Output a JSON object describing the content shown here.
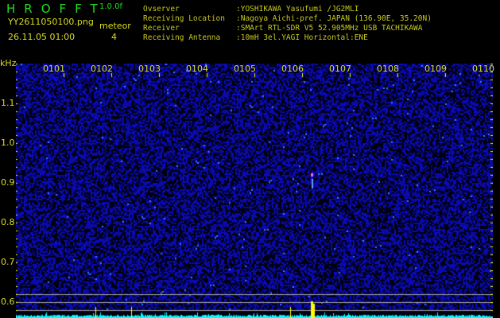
{
  "header": {
    "title": "HROFFT",
    "version": "1.0.0f",
    "filename": "YY2611050100.png",
    "datetime": "26.11.05 01:00",
    "meteor_label": "meteor",
    "meteor_count": "4"
  },
  "info": [
    {
      "label": "Ovserver",
      "value": ":YOSHIKAWA Yasufumi /JG2MLI"
    },
    {
      "label": "Receiving Location",
      "value": ":Nagoya Aichi-pref. JAPAN (136.90E, 35.20N)"
    },
    {
      "label": "Receiver",
      "value": ":SMArt RTL-SDR V5 52.905MHz USB TACHIKAWA"
    },
    {
      "label": "Receiving Antenna",
      "value": ":10mH 3el.YAGI Horizontal:ENE"
    }
  ],
  "spectrogram": {
    "y_unit": "kHz",
    "x_labels": [
      "0101",
      "0102",
      "0103",
      "0104",
      "0105",
      "0106",
      "0107",
      "0108",
      "0109",
      "0110"
    ],
    "y_labels": [
      "1.1",
      "1.0",
      "0.9",
      "0.8",
      "0.7",
      "0.6"
    ],
    "colors": {
      "background": "#000010",
      "noise": "#2020c0",
      "baseline": "#00ffff",
      "marker": "#ffff00",
      "guide": "#a0a0a0"
    }
  }
}
